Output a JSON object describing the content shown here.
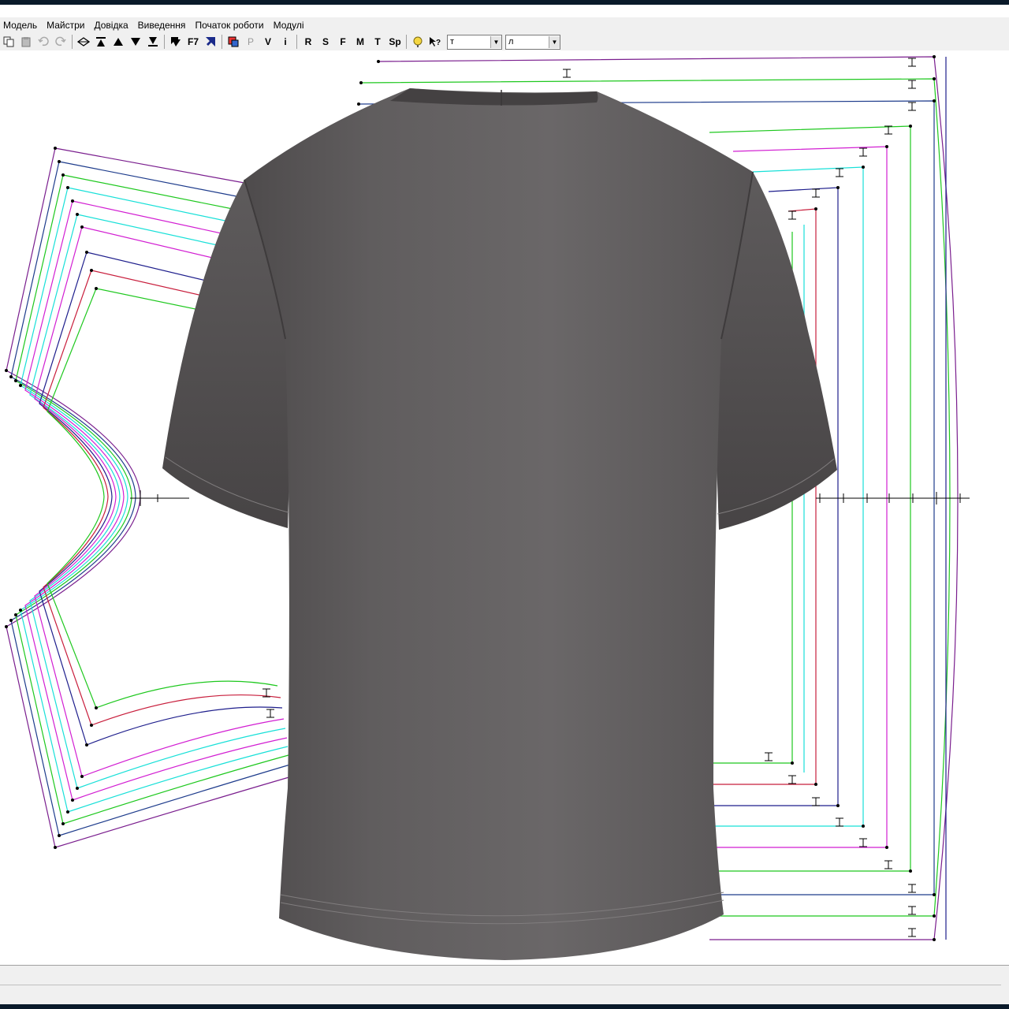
{
  "menu": {
    "items": [
      "Модель",
      "Майстри",
      "Довідка",
      "Виведення",
      "Початок роботи",
      "Модулі"
    ]
  },
  "toolbar": {
    "text_buttons": {
      "f7": "F7",
      "p": "P",
      "v": "V",
      "i": "i",
      "r": "R",
      "s": "S",
      "f": "F",
      "m": "M",
      "t": "T",
      "sp": "Sp"
    },
    "combo1_value": "т",
    "combo2_value": "л"
  },
  "colors": {
    "accent_purple": "#7a1e8e",
    "line_green": "#1ec81e",
    "line_cyan": "#18e0d8",
    "line_magenta": "#d21ed2",
    "line_red": "#c81e3c",
    "line_blue": "#1e1e8c",
    "shirt": "#5f5c5d"
  }
}
